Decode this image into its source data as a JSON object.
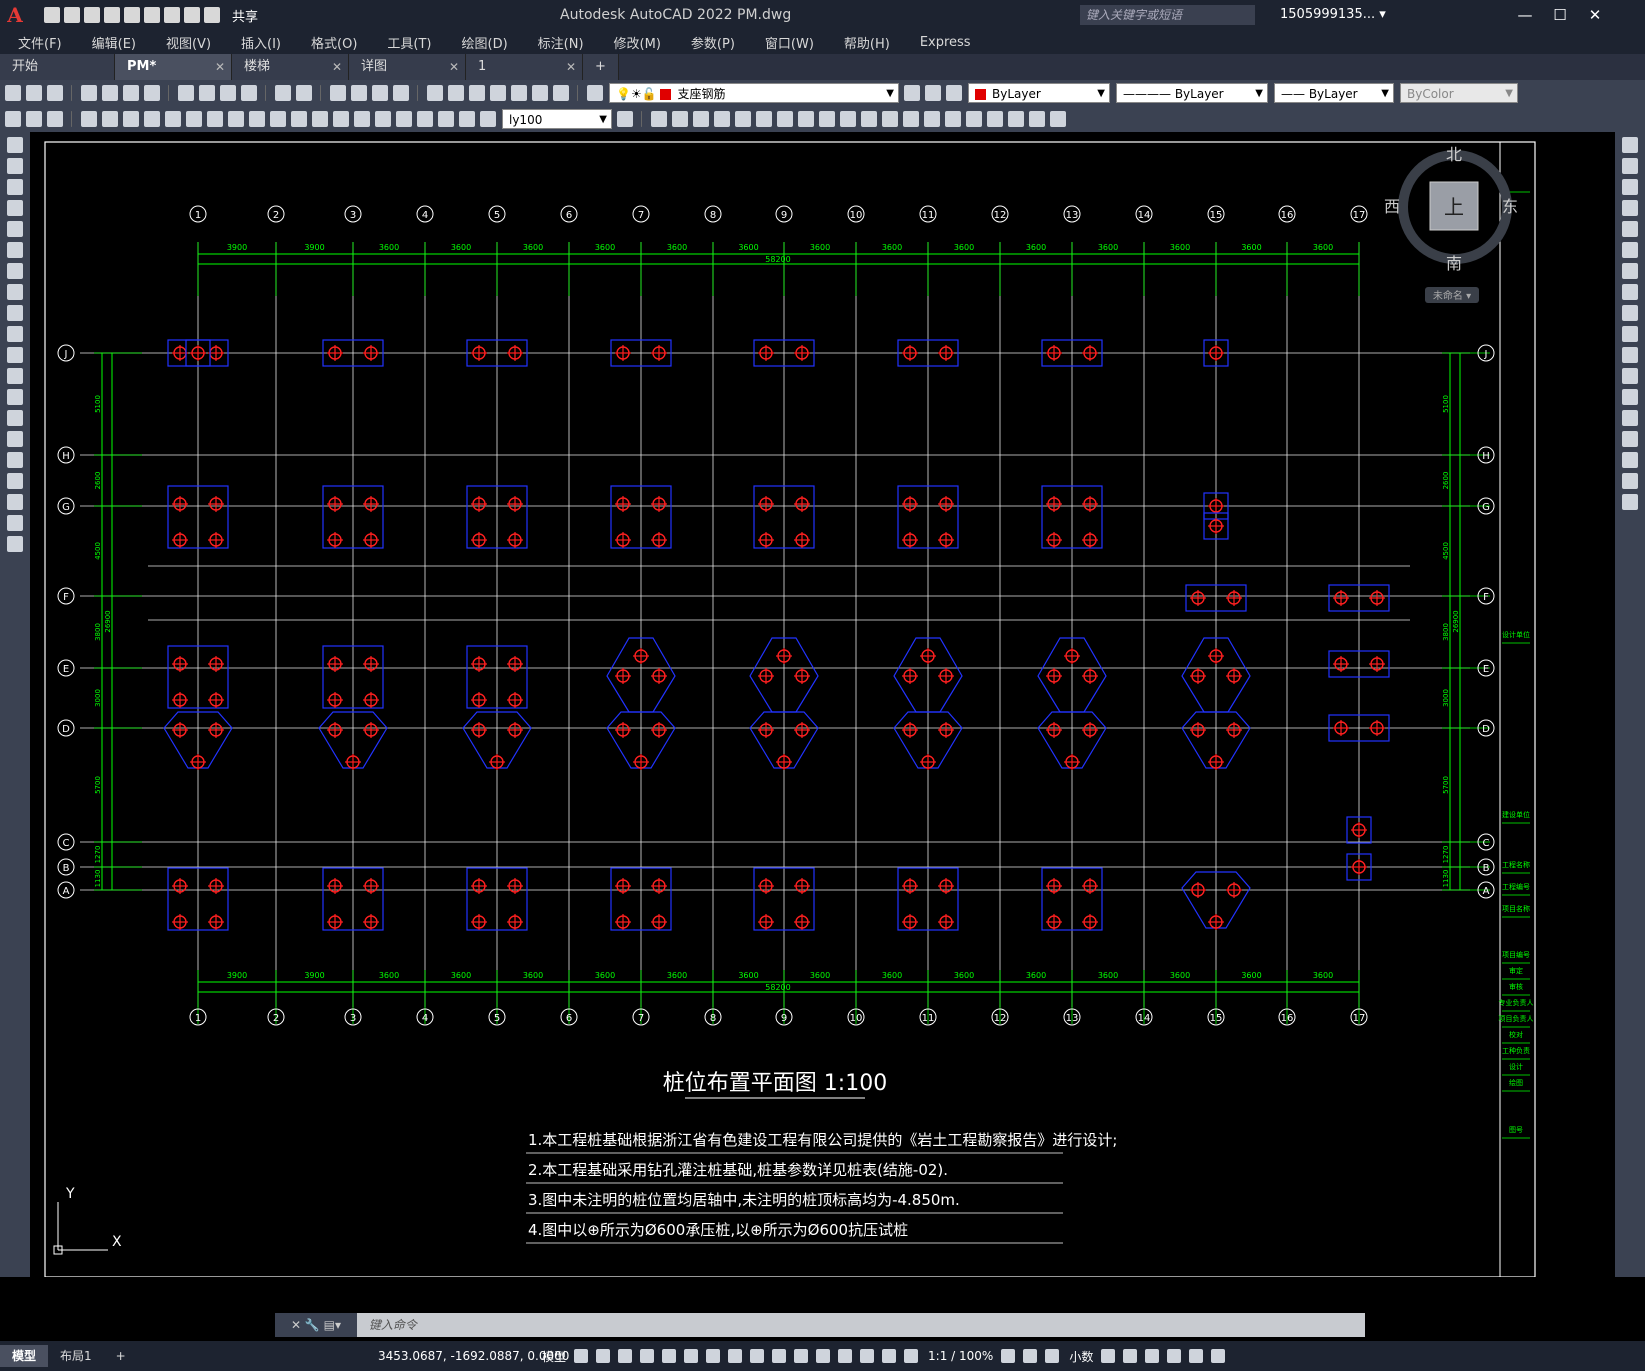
{
  "app": {
    "title": "Autodesk AutoCAD 2022    PM.dwg",
    "share_label": "共享",
    "search_placeholder": "键入关键字或短语",
    "user": "1505999135... ▾",
    "logo": "A"
  },
  "menu": [
    "文件(F)",
    "编辑(E)",
    "视图(V)",
    "插入(I)",
    "格式(O)",
    "工具(T)",
    "绘图(D)",
    "标注(N)",
    "修改(M)",
    "参数(P)",
    "窗口(W)",
    "帮助(H)",
    "Express"
  ],
  "tabs": [
    {
      "label": "开始",
      "active": false,
      "closable": false
    },
    {
      "label": "PM*",
      "active": true,
      "closable": true
    },
    {
      "label": "楼梯",
      "active": false,
      "closable": true
    },
    {
      "label": "详图",
      "active": false,
      "closable": true
    },
    {
      "label": "1",
      "active": false,
      "closable": true
    }
  ],
  "toolbar": {
    "layer_name": "支座钢筋",
    "color": "ByLayer",
    "linetype": "ByLayer",
    "lineweight": "ByLayer",
    "plotstyle": "ByColor",
    "dimstyle": "ly100"
  },
  "viewcube": {
    "north": "北",
    "south": "南",
    "east": "东",
    "west": "西",
    "face": "上",
    "ucs": "未命名 ▾"
  },
  "drawing": {
    "title": "桩位布置平面图  1:100",
    "notes": [
      "1.本工程桩基础根据浙江省有色建设工程有限公司提供的《岩土工程勘察报告》进行设计;",
      "2.本工程基础采用钻孔灌注桩基础,桩基参数详见桩表(结施-02).",
      "3.图中未注明的桩位置均居轴中,未注明的桩顶标高均为-4.850m.",
      "4.图中以⊕所示为Ø600承压桩,以⊕所示为Ø600抗压试桩"
    ],
    "col_axes": [
      "1",
      "2",
      "3",
      "4",
      "5",
      "6",
      "7",
      "8",
      "9",
      "10",
      "11",
      "12",
      "13",
      "14",
      "15",
      "16",
      "17"
    ],
    "row_axes": [
      "J",
      "H",
      "G",
      "F",
      "E",
      "D",
      "C",
      "B",
      "A"
    ],
    "top_spans": [
      "3900",
      "3900",
      "3600",
      "3600",
      "3600",
      "3600",
      "3600",
      "3600",
      "3600",
      "3600",
      "3600",
      "3600",
      "3600",
      "3600",
      "3600",
      "3600"
    ],
    "total_width": "58200",
    "left_spans": [
      "5100",
      "2600",
      "4500",
      "3800",
      "3000",
      "5700",
      "1270",
      "1130"
    ],
    "total_height": "26900",
    "right_labels": [
      "设计单位",
      "建设单位",
      "工程名称",
      "工程编号",
      "项目名称",
      "项目编号",
      "审定",
      "审核",
      "专业负责人",
      "项目负责人",
      "校对",
      "工种负责",
      "设计",
      "绘图",
      "图号"
    ],
    "ucs_x": "X",
    "ucs_y": "Y"
  },
  "command": {
    "placeholder": "键入命令"
  },
  "status": {
    "model_tab": "模型",
    "layout_tab": "布局1",
    "coords": "3453.0687, -1692.0887, 0.0000",
    "mode": "模型",
    "scale": "1:1 / 100%",
    "units": "小数"
  }
}
